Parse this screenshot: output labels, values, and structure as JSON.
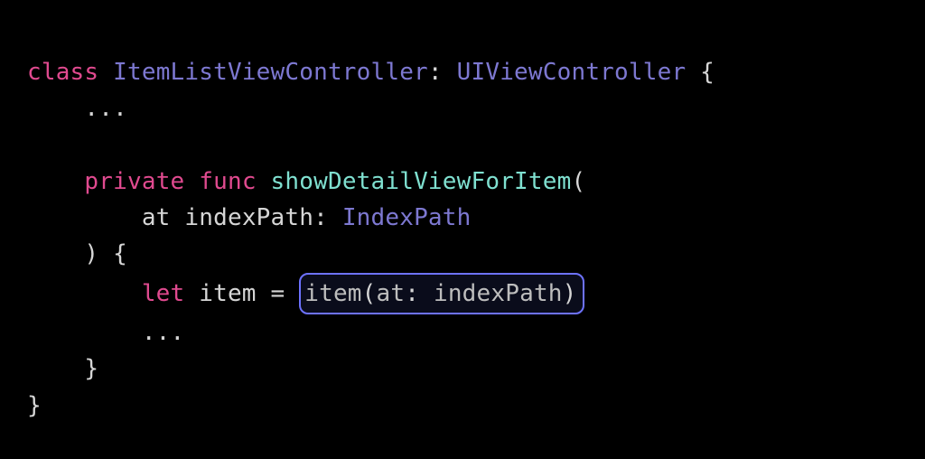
{
  "code": {
    "kw_class": "class",
    "class_name": "ItemListViewController",
    "colon1": ":",
    "superclass": "UIViewController",
    "open_brace1": "{",
    "ellipsis1": "...",
    "kw_private": "private",
    "kw_func": "func",
    "func_name": "showDetailViewForItem",
    "open_paren1": "(",
    "param_label_at": "at",
    "param_name": "indexPath",
    "colon2": ":",
    "param_type": "IndexPath",
    "close_paren1": ")",
    "open_brace2": "{",
    "kw_let": "let",
    "var_item": "item",
    "equals": "=",
    "call_name": "item",
    "call_open": "(",
    "call_arg_label": "at",
    "call_arg_colon": ":",
    "call_arg_value": "indexPath",
    "call_close": ")",
    "ellipsis2": "...",
    "close_brace2": "}",
    "close_brace1": "}"
  },
  "highlight": {
    "expression": "item(at: indexPath)"
  }
}
